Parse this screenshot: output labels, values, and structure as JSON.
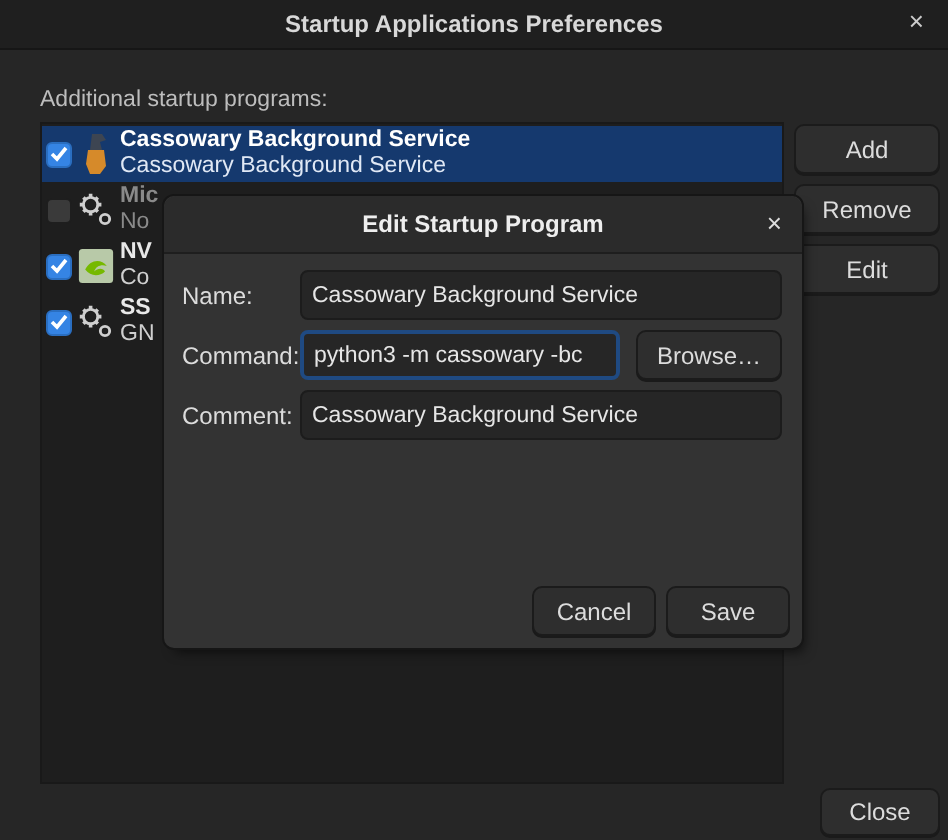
{
  "window": {
    "title": "Startup Applications Preferences",
    "close": "×"
  },
  "list_label": "Additional startup programs:",
  "programs": [
    {
      "name": "Cassowary Background Service",
      "comment": "Cassowary Background Service",
      "checked": true,
      "selected": true,
      "kind": "bird"
    },
    {
      "name": "Mic",
      "comment": "No",
      "checked": false,
      "selected": false,
      "kind": "gears"
    },
    {
      "name": "NV",
      "comment": "Co",
      "checked": true,
      "selected": false,
      "kind": "chip"
    },
    {
      "name": "SS",
      "comment": "GN",
      "checked": true,
      "selected": false,
      "kind": "gears"
    }
  ],
  "side_buttons": [
    "Add",
    "Remove",
    "Edit"
  ],
  "close_button": "Close",
  "dialog": {
    "title": "Edit Startup Program",
    "close": "×",
    "fields": [
      {
        "label": "Name:",
        "value": "Cassowary Background Service",
        "focused": false
      },
      {
        "label": "Command:",
        "value": "python3 -m cassowary -bc",
        "focused": true,
        "browse": "Browse…"
      },
      {
        "label": "Comment:",
        "value": "Cassowary Background Service",
        "focused": false
      }
    ],
    "buttons": [
      "Cancel",
      "Save"
    ]
  }
}
